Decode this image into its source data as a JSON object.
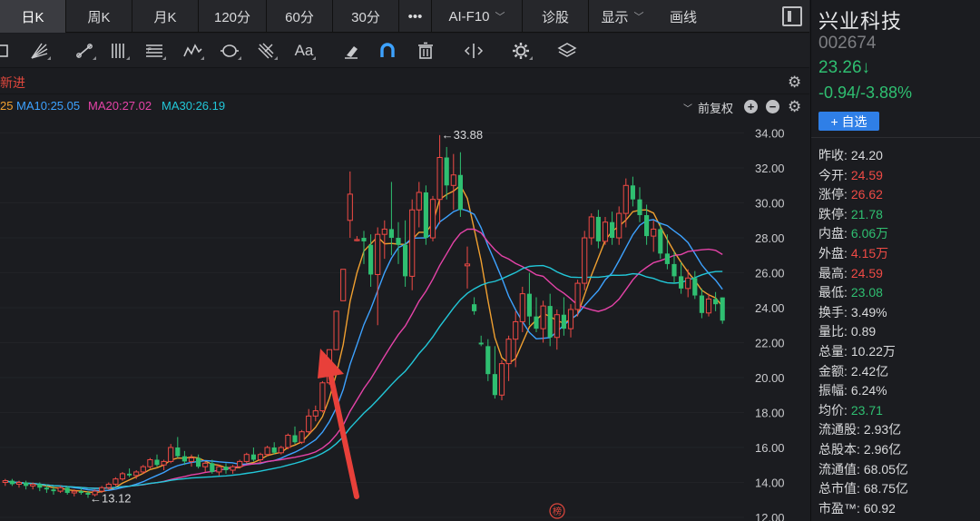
{
  "topbar": {
    "tabs": [
      {
        "label": "日K",
        "active": true
      },
      {
        "label": "周K"
      },
      {
        "label": "月K"
      },
      {
        "label": "120分"
      },
      {
        "label": "60分"
      },
      {
        "label": "30分"
      },
      {
        "label": "•••"
      },
      {
        "label": "AI-F10",
        "dropdown": true
      },
      {
        "label": "诊股"
      }
    ],
    "display_label": "显示",
    "draw_label": "画线"
  },
  "toolbar_icons": [
    "rectangle-icon",
    "fan-icon",
    "trend-line-icon",
    "parallel-lines-icon",
    "fibonacci-icon",
    "wave-icon",
    "cycle-icon",
    "gann-icon",
    "text-tool-icon",
    "eraser-icon",
    "magnet-icon",
    "trash-icon",
    "ruler-icon",
    "settings-icon",
    "layers-icon"
  ],
  "strip": {
    "new_label": "新进",
    "ma_first": {
      "text": "25",
      "color": "#f0a030"
    },
    "ma10": {
      "text": "MA10:25.05",
      "color": "#3da2ff"
    },
    "ma20": {
      "text": "MA20:27.02",
      "color": "#e543a8"
    },
    "ma30": {
      "text": "MA30:26.19",
      "color": "#22c7d8"
    },
    "adjust_label": "前复权"
  },
  "stock": {
    "name": "兴业科技",
    "code": "002674",
    "price": "23.26↓",
    "change": "-0.94/-3.88%",
    "add_button": "+ 自选"
  },
  "stats": [
    {
      "label": "昨收:",
      "value": "24.20",
      "color": "#d9dadc"
    },
    {
      "label": "今开:",
      "value": "24.59",
      "color": "#ef4a45"
    },
    {
      "label": "涨停:",
      "value": "26.62",
      "color": "#ef4a45"
    },
    {
      "label": "跌停:",
      "value": "21.78",
      "color": "#2fbf71"
    },
    {
      "label": "内盘:",
      "value": "6.06万",
      "color": "#2fbf71"
    },
    {
      "label": "外盘:",
      "value": "4.15万",
      "color": "#ef4a45"
    },
    {
      "label": "最高:",
      "value": "24.59",
      "color": "#ef4a45"
    },
    {
      "label": "最低:",
      "value": "23.08",
      "color": "#2fbf71"
    },
    {
      "label": "换手:",
      "value": "3.49%",
      "color": "#d9dadc"
    },
    {
      "label": "量比:",
      "value": "0.89",
      "color": "#d9dadc"
    },
    {
      "label": "总量:",
      "value": "10.22万",
      "color": "#d9dadc"
    },
    {
      "label": "金额:",
      "value": "2.42亿",
      "color": "#d9dadc"
    },
    {
      "label": "振幅:",
      "value": "6.24%",
      "color": "#d9dadc"
    },
    {
      "label": "均价:",
      "value": "23.71",
      "color": "#2fbf71"
    },
    {
      "label": "流通股:",
      "value": "2.93亿",
      "color": "#d9dadc"
    },
    {
      "label": "总股本:",
      "value": "2.96亿",
      "color": "#d9dadc"
    },
    {
      "label": "流通值:",
      "value": "68.05亿",
      "color": "#d9dadc"
    },
    {
      "label": "总市值:",
      "value": "68.75亿",
      "color": "#d9dadc"
    },
    {
      "label": "市盈™:",
      "value": "60.92",
      "color": "#d9dadc"
    }
  ],
  "chart_data": {
    "type": "candlestick",
    "y_ticks": [
      "34.00",
      "32.00",
      "30.00",
      "28.00",
      "26.00",
      "24.00",
      "22.00",
      "20.00",
      "18.00",
      "16.00",
      "14.00",
      "12.00"
    ],
    "ylim": [
      12,
      34.6
    ],
    "annotations": {
      "high": "←33.88",
      "low": "←13.12",
      "badge": "榜"
    },
    "ohlc": [
      [
        14.0,
        14.2,
        13.8,
        14.1
      ],
      [
        14.1,
        14.2,
        13.8,
        13.9
      ],
      [
        13.9,
        14.1,
        13.7,
        14.0
      ],
      [
        14.0,
        14.1,
        13.6,
        13.8
      ],
      [
        13.8,
        14.0,
        13.6,
        13.9
      ],
      [
        13.9,
        14.0,
        13.5,
        13.7
      ],
      [
        13.7,
        13.9,
        13.4,
        13.6
      ],
      [
        13.6,
        13.8,
        13.3,
        13.5
      ],
      [
        13.5,
        13.8,
        13.4,
        13.7
      ],
      [
        13.7,
        13.8,
        13.3,
        13.4
      ],
      [
        13.4,
        13.6,
        13.2,
        13.5
      ],
      [
        13.5,
        13.7,
        13.3,
        13.4
      ],
      [
        13.4,
        13.5,
        13.12,
        13.3
      ],
      [
        13.3,
        13.6,
        13.2,
        13.5
      ],
      [
        13.5,
        13.8,
        13.4,
        13.7
      ],
      [
        13.7,
        14.0,
        13.6,
        13.9
      ],
      [
        13.9,
        14.3,
        13.8,
        14.2
      ],
      [
        14.2,
        14.6,
        14.1,
        14.5
      ],
      [
        14.5,
        14.8,
        14.3,
        14.4
      ],
      [
        14.4,
        14.7,
        14.2,
        14.6
      ],
      [
        14.6,
        15.0,
        14.5,
        14.9
      ],
      [
        14.9,
        15.4,
        14.8,
        15.3
      ],
      [
        15.3,
        15.6,
        14.9,
        15.0
      ],
      [
        15.0,
        15.3,
        14.7,
        15.2
      ],
      [
        15.2,
        16.2,
        15.1,
        16.0
      ],
      [
        16.0,
        16.6,
        15.4,
        15.5
      ],
      [
        15.5,
        15.8,
        15.0,
        15.2
      ],
      [
        15.2,
        15.6,
        14.9,
        15.4
      ],
      [
        15.4,
        15.6,
        14.8,
        14.9
      ],
      [
        14.9,
        15.2,
        14.6,
        15.1
      ],
      [
        15.1,
        15.3,
        14.5,
        14.6
      ],
      [
        14.6,
        15.0,
        14.4,
        14.9
      ],
      [
        14.9,
        15.1,
        14.5,
        14.7
      ],
      [
        14.7,
        15.0,
        14.5,
        14.9
      ],
      [
        14.9,
        15.3,
        14.8,
        15.2
      ],
      [
        15.2,
        15.7,
        15.1,
        15.6
      ],
      [
        15.6,
        16.0,
        15.2,
        15.3
      ],
      [
        15.3,
        15.7,
        15.1,
        15.6
      ],
      [
        15.6,
        16.1,
        15.5,
        16.0
      ],
      [
        16.0,
        16.3,
        15.6,
        15.7
      ],
      [
        15.7,
        16.1,
        15.6,
        16.0
      ],
      [
        16.0,
        16.8,
        15.9,
        16.7
      ],
      [
        16.7,
        17.2,
        16.2,
        16.3
      ],
      [
        16.3,
        17.0,
        16.2,
        16.9
      ],
      [
        16.9,
        18.2,
        16.8,
        17.8
      ],
      [
        17.8,
        18.4,
        17.5,
        18.1
      ],
      [
        18.1,
        19.8,
        18.0,
        19.7
      ],
      [
        19.7,
        21.6,
        19.6,
        21.6
      ],
      [
        21.6,
        23.8,
        21.6,
        23.8
      ],
      [
        24.4,
        26.2,
        24.4,
        26.2
      ],
      [
        29.0,
        31.8,
        28.0,
        30.5
      ],
      [
        27.9,
        28.1,
        27.8,
        27.9
      ],
      [
        28.0,
        28.4,
        26.5,
        27.8
      ],
      [
        27.6,
        28.2,
        25.2,
        25.9
      ],
      [
        25.9,
        28.6,
        23.0,
        28.2
      ],
      [
        28.2,
        29.0,
        26.8,
        28.5
      ],
      [
        28.5,
        31.2,
        27.0,
        28.0
      ],
      [
        28.0,
        28.9,
        26.5,
        27.6
      ],
      [
        27.6,
        29.0,
        25.2,
        25.8
      ],
      [
        25.8,
        30.2,
        25.0,
        29.6
      ],
      [
        29.6,
        31.2,
        28.6,
        30.6
      ],
      [
        30.6,
        31.0,
        27.6,
        28.0
      ],
      [
        28.0,
        30.4,
        27.8,
        30.2
      ],
      [
        30.2,
        33.88,
        28.8,
        32.6
      ],
      [
        32.6,
        33.2,
        30.2,
        31.0
      ],
      [
        31.0,
        32.8,
        29.6,
        31.6
      ],
      [
        31.6,
        32.9,
        29.2,
        29.6
      ],
      [
        26.4,
        27.5,
        25.1,
        26.5
      ],
      [
        24.2,
        24.6,
        23.6,
        23.8
      ],
      [
        22.0,
        22.4,
        21.8,
        21.9
      ],
      [
        21.8,
        22.2,
        19.8,
        20.2
      ],
      [
        20.2,
        21.8,
        18.8,
        19.0
      ],
      [
        19.0,
        21.0,
        18.7,
        20.8
      ],
      [
        20.8,
        22.4,
        19.8,
        22.2
      ],
      [
        22.2,
        23.8,
        20.6,
        23.2
      ],
      [
        23.2,
        25.2,
        22.6,
        24.8
      ],
      [
        24.8,
        26.0,
        23.0,
        23.5
      ],
      [
        23.5,
        24.6,
        22.6,
        22.8
      ],
      [
        22.8,
        24.4,
        22.0,
        24.1
      ],
      [
        24.1,
        24.8,
        21.8,
        22.3
      ],
      [
        22.3,
        23.9,
        21.6,
        23.6
      ],
      [
        23.6,
        24.6,
        22.4,
        22.8
      ],
      [
        22.8,
        24.2,
        22.3,
        23.9
      ],
      [
        23.9,
        25.6,
        23.5,
        25.4
      ],
      [
        25.4,
        28.4,
        25.0,
        28.0
      ],
      [
        28.0,
        29.4,
        27.6,
        29.2
      ],
      [
        29.2,
        29.6,
        27.4,
        27.8
      ],
      [
        27.8,
        29.2,
        27.6,
        28.9
      ],
      [
        28.9,
        29.5,
        27.6,
        28.0
      ],
      [
        28.0,
        29.8,
        27.6,
        29.4
      ],
      [
        29.4,
        31.4,
        28.6,
        31.0
      ],
      [
        31.0,
        31.5,
        29.8,
        30.2
      ],
      [
        30.2,
        30.9,
        28.9,
        29.3
      ],
      [
        29.3,
        29.9,
        27.6,
        28.1
      ],
      [
        28.1,
        29.0,
        27.2,
        28.5
      ],
      [
        28.5,
        28.8,
        26.8,
        27.1
      ],
      [
        27.1,
        28.2,
        26.2,
        26.5
      ],
      [
        26.5,
        27.2,
        25.4,
        25.8
      ],
      [
        25.8,
        26.6,
        24.8,
        25.1
      ],
      [
        25.1,
        26.2,
        24.6,
        25.7
      ],
      [
        25.7,
        26.1,
        24.5,
        24.7
      ],
      [
        24.7,
        25.1,
        23.4,
        23.7
      ],
      [
        23.7,
        24.8,
        23.5,
        24.5
      ],
      [
        24.5,
        24.9,
        23.8,
        24.2
      ],
      [
        24.59,
        24.59,
        23.08,
        23.26
      ]
    ]
  }
}
